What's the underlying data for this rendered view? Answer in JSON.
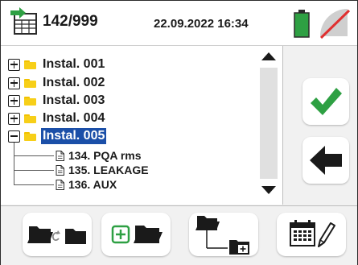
{
  "header": {
    "memory_count": "142/999",
    "datetime": "22.09.2022 16:34",
    "battery_color": "#2ea043",
    "wifi_state": "disabled"
  },
  "tree": {
    "folders": [
      {
        "label": "Instal. 001",
        "expanded": false,
        "selected": false
      },
      {
        "label": "Instal. 002",
        "expanded": false,
        "selected": false
      },
      {
        "label": "Instal. 003",
        "expanded": false,
        "selected": false
      },
      {
        "label": "Instal. 004",
        "expanded": false,
        "selected": false
      },
      {
        "label": "Instal. 005",
        "expanded": true,
        "selected": true
      }
    ],
    "files": [
      {
        "label": "134. PQA rms"
      },
      {
        "label": "135. LEAKAGE"
      },
      {
        "label": "136. AUX"
      }
    ]
  },
  "side_buttons": {
    "confirm_icon": "checkmark-icon",
    "back_icon": "arrow-left-icon",
    "accent_green": "#2ea043"
  },
  "toolbar": {
    "buttons": [
      {
        "name": "rename-folder-button",
        "icon": "folder-swap-icon"
      },
      {
        "name": "new-folder-button",
        "icon": "folder-add-icon"
      },
      {
        "name": "new-subfolder-button",
        "icon": "subfolder-add-icon"
      },
      {
        "name": "edit-date-button",
        "icon": "calendar-edit-icon"
      }
    ]
  }
}
